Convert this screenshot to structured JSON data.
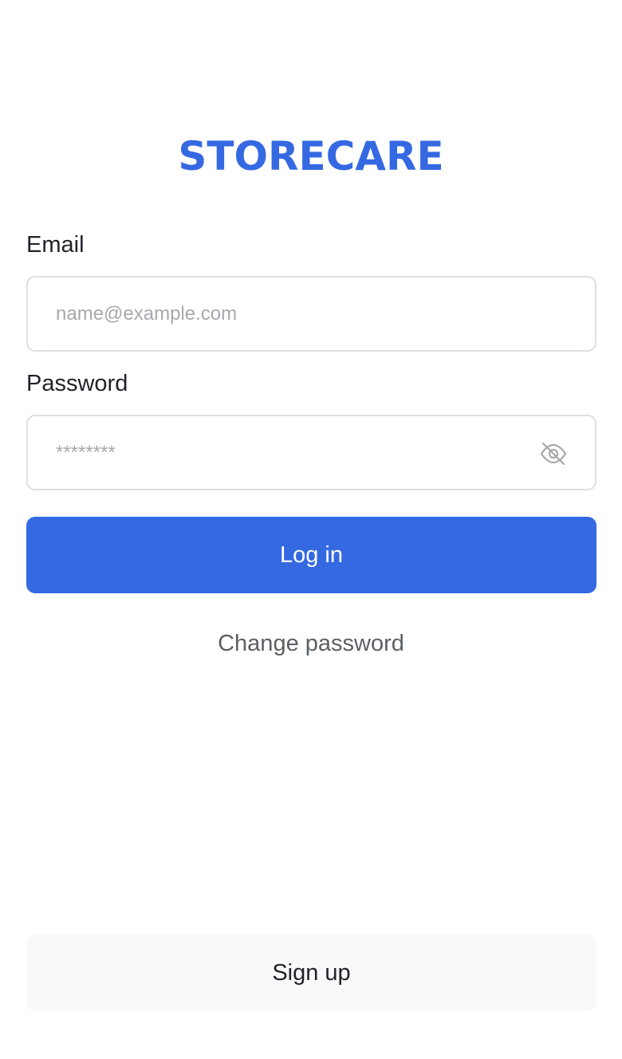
{
  "brand": {
    "logo_text": "STORECARE",
    "accent_color": "#3569e2"
  },
  "form": {
    "email": {
      "label": "Email",
      "placeholder": "name@example.com",
      "value": ""
    },
    "password": {
      "label": "Password",
      "placeholder": "********",
      "value": "",
      "visibility_icon": "eye-off-icon"
    },
    "login_button_label": "Log in",
    "change_password_link": "Change password"
  },
  "footer": {
    "signup_button_label": "Sign up"
  }
}
